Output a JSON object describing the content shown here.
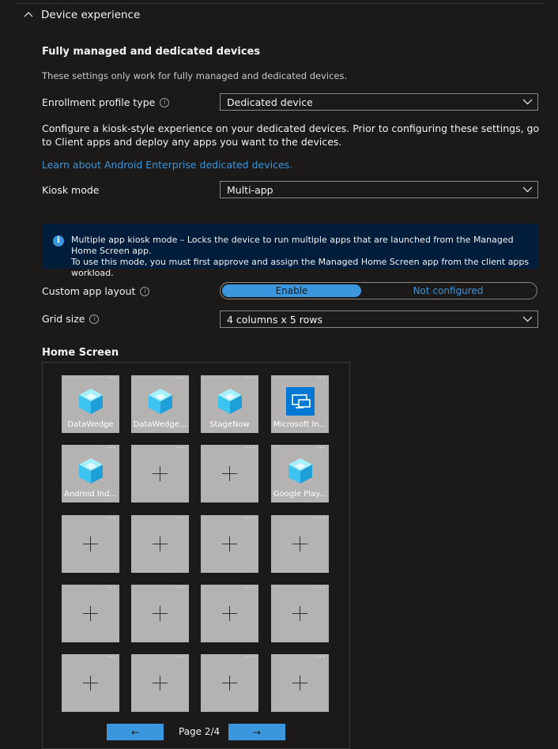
{
  "section": {
    "title": "Device experience"
  },
  "fully_managed": {
    "title": "Fully managed and dedicated devices",
    "description": "These settings only work for fully managed and dedicated devices."
  },
  "enrollment": {
    "label": "Enrollment profile type",
    "value": "Dedicated device"
  },
  "kiosk_intro": "Configure a kiosk-style experience on your dedicated devices. Prior to configuring these settings, go to Client apps and deploy any apps you want to the devices.",
  "learn_link": "Learn about Android Enterprise dedicated devices.",
  "kiosk_mode": {
    "label": "Kiosk mode",
    "value": "Multi-app"
  },
  "info_banner": {
    "line1": "Multiple app kiosk mode – Locks the device to run multiple apps that are launched from the Managed Home Screen app.",
    "line2": "To use this mode, you must first approve and assign the Managed Home Screen app from the client apps workload."
  },
  "custom_layout": {
    "label": "Custom app layout",
    "enable": "Enable",
    "not_configured": "Not configured",
    "selected": "Enable"
  },
  "grid_size": {
    "label": "Grid size",
    "value": "4 columns x 5 rows"
  },
  "home_screen": {
    "title": "Home Screen",
    "tiles": [
      {
        "label": "DataWedge",
        "icon": "cube-app-icon"
      },
      {
        "label": "DataWedge...",
        "icon": "cube-app-icon"
      },
      {
        "label": "StageNow",
        "icon": "cube-app-icon"
      },
      {
        "label": "Microsoft In...",
        "icon": "intune-app-icon"
      },
      {
        "label": "Android Ind...",
        "icon": "cube-app-icon"
      },
      {
        "label": "",
        "icon": "add-icon"
      },
      {
        "label": "",
        "icon": "add-icon"
      },
      {
        "label": "Google Play...",
        "icon": "cube-app-icon"
      },
      {
        "label": "",
        "icon": "add-icon"
      },
      {
        "label": "",
        "icon": "add-icon"
      },
      {
        "label": "",
        "icon": "add-icon"
      },
      {
        "label": "",
        "icon": "add-icon"
      },
      {
        "label": "",
        "icon": "add-icon"
      },
      {
        "label": "",
        "icon": "add-icon"
      },
      {
        "label": "",
        "icon": "add-icon"
      },
      {
        "label": "",
        "icon": "add-icon"
      },
      {
        "label": "",
        "icon": "add-icon"
      },
      {
        "label": "",
        "icon": "add-icon"
      },
      {
        "label": "",
        "icon": "add-icon"
      },
      {
        "label": "",
        "icon": "add-icon"
      }
    ],
    "more_glyph": "···",
    "pager": {
      "text": "Page 2/4",
      "prev": "←",
      "next": "→"
    }
  },
  "colors": {
    "background": "#1b1a19",
    "accent": "#3a96dd",
    "banner": "#001e3c",
    "tile": "#b4b3b2"
  }
}
